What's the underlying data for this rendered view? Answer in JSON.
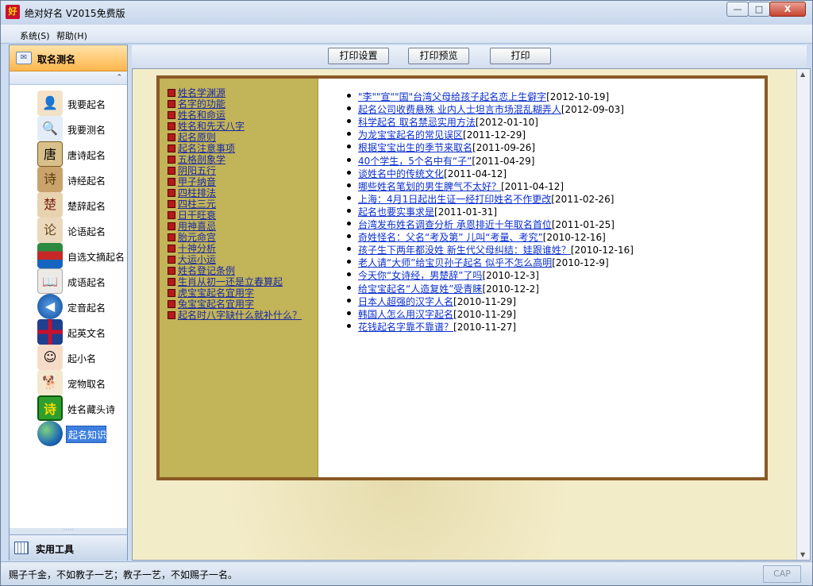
{
  "window": {
    "title": "绝对好名 V2015免费版",
    "app_icon": "好",
    "controls": {
      "minimize": "—",
      "maximize": "□",
      "close": "X"
    }
  },
  "menu": [
    {
      "label": "系统(S)"
    },
    {
      "label": "帮助(H)"
    }
  ],
  "sidebar": {
    "header": "取名测名",
    "collapse_glyph": "⌃",
    "items": [
      {
        "label": "我要起名",
        "icon": "person-icon"
      },
      {
        "label": "我要测名",
        "icon": "magnifier-person-icon"
      },
      {
        "label": "唐诗起名",
        "icon": "tang-poetry-icon",
        "glyph": "唐"
      },
      {
        "label": "诗经起名",
        "icon": "shijing-book-icon",
        "glyph": "诗"
      },
      {
        "label": "楚辞起名",
        "icon": "chuci-book-icon",
        "glyph": "楚"
      },
      {
        "label": "论语起名",
        "icon": "lunyu-book-icon",
        "glyph": "论"
      },
      {
        "label": "自选文摘起名",
        "icon": "books-stack-icon"
      },
      {
        "label": "成语起名",
        "icon": "idiom-book-icon"
      },
      {
        "label": "定音起名",
        "icon": "audio-icon"
      },
      {
        "label": "起英文名",
        "icon": "uk-flag-icon"
      },
      {
        "label": "起小名",
        "icon": "baby-icon"
      },
      {
        "label": "宠物取名",
        "icon": "dog-icon"
      },
      {
        "label": "姓名藏头诗",
        "icon": "poem-character-icon",
        "glyph": "诗"
      },
      {
        "label": "起名知识",
        "icon": "globe-icon",
        "selected": true
      }
    ],
    "footer": "实用工具"
  },
  "toolbar": {
    "print_setup": "打印设置",
    "print_preview": "打印预览",
    "print": "打印"
  },
  "knowledge_links": [
    "姓名学渊源",
    "名字的功能",
    "姓名和命运",
    "姓名和先天八字",
    "起名原则",
    "起名注意事项",
    "五格剖象学",
    "阴阳五行",
    "甲子纳音",
    "四柱排法",
    "四柱三元",
    "日干旺衰",
    "用神喜忌",
    "胎元命宫",
    "十神分析",
    "大运小运",
    "姓名登记条例",
    "生肖从初一还是立春算起",
    "虎宝宝起名宜用字",
    "兔宝宝起名宜用字",
    "起名时八字缺什么就补什么？"
  ],
  "news": [
    {
      "title": "\"李\"\"宣\"\"国\"台湾父母给孩子起名恋上生僻字",
      "date": "[2012-10-19]"
    },
    {
      "title": "起名公司收费悬殊 业内人士坦言市场混乱糊弄人",
      "date": "[2012-09-03]"
    },
    {
      "title": "科学起名 取名禁忌实用方法",
      "date": "[2012-01-10]"
    },
    {
      "title": "为龙宝宝起名的常见误区",
      "date": "[2011-12-29]"
    },
    {
      "title": "根据宝宝出生的季节来取名",
      "date": "[2011-09-26]"
    },
    {
      "title": "40个学生，5个名中有“子”",
      "date": "[2011-04-29]"
    },
    {
      "title": "谈姓名中的传统文化",
      "date": "[2011-04-12]"
    },
    {
      "title": "哪些姓名笔划的男生脾气不太好？",
      "date": "[2011-04-12]"
    },
    {
      "title": "上海：4月1日起出生证一经打印姓名不作更改",
      "date": "[2011-02-26]"
    },
    {
      "title": "起名也要实事求是",
      "date": "[2011-01-31]"
    },
    {
      "title": "台湾发布姓名调查分析 承恩排近十年取名首位",
      "date": "[2011-01-25]"
    },
    {
      "title": "奇姓怪名：父名“考及第” 儿叫“考量、考究”",
      "date": "[2010-12-16]"
    },
    {
      "title": "孩子生下两年都没姓 新生代父母纠结：娃跟谁姓？",
      "date": "[2010-12-16]"
    },
    {
      "title": "老人请“大师”给宝贝孙子起名 似乎不怎么高明",
      "date": "[2010-12-9]"
    },
    {
      "title": "今天你“女诗经，男楚辞”了吗",
      "date": "[2010-12-3]"
    },
    {
      "title": "给宝宝起名“人造复姓”受青睐",
      "date": "[2010-12-2]"
    },
    {
      "title": "日本人超强的汉字人名",
      "date": "[2010-11-29]"
    },
    {
      "title": "韩国人怎么用汉字起名",
      "date": "[2010-11-29]"
    },
    {
      "title": "花钱起名字靠不靠谱？",
      "date": "[2010-11-27]"
    }
  ],
  "status": {
    "text": "赐子千金，不如教子一艺；教子一艺，不如赐子一名。",
    "cap": "CAP"
  }
}
